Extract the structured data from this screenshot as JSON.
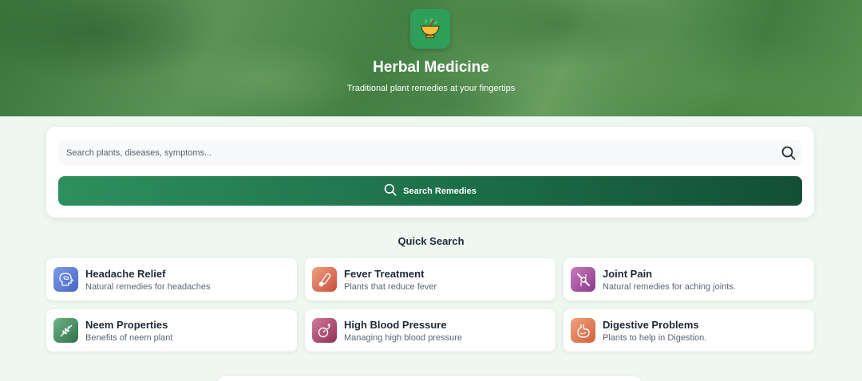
{
  "header": {
    "title": "Herbal Medicine",
    "subtitle": "Traditional plant remedies at your fingertips",
    "logo_icon": "mortar-pestle-herb-icon"
  },
  "search": {
    "placeholder": "Search plants, diseases, symptoms...",
    "value": "",
    "button_label": "Search Remedies"
  },
  "quick_search": {
    "title": "Quick Search",
    "items": [
      {
        "title": "Headache Relief",
        "description": "Natural remedies for headaches",
        "icon": "head-brain-icon",
        "color": "#5b7bd5"
      },
      {
        "title": "Fever Treatment",
        "description": "Plants that reduce fever",
        "icon": "thermometer-icon",
        "color": "#d9694a"
      },
      {
        "title": "Joint Pain",
        "description": "Natural remedies for aching joints.",
        "icon": "joint-bone-icon",
        "color": "#a44c9a"
      },
      {
        "title": "Neem Properties",
        "description": "Benefits of neem plant",
        "icon": "neem-leaf-icon",
        "color": "#3f8a5a"
      },
      {
        "title": "High Blood Pressure",
        "description": "Managing high blood pressure",
        "icon": "blood-pressure-icon",
        "color": "#b0456a"
      },
      {
        "title": "Digestive Problems",
        "description": "Plants to help in Digestion.",
        "icon": "stomach-icon",
        "color": "#e07a52"
      }
    ]
  },
  "colors": {
    "accent": "#2f9e5b",
    "button_start": "#2e8f5e",
    "button_end": "#134f35",
    "page_bg": "#eef7f0"
  }
}
